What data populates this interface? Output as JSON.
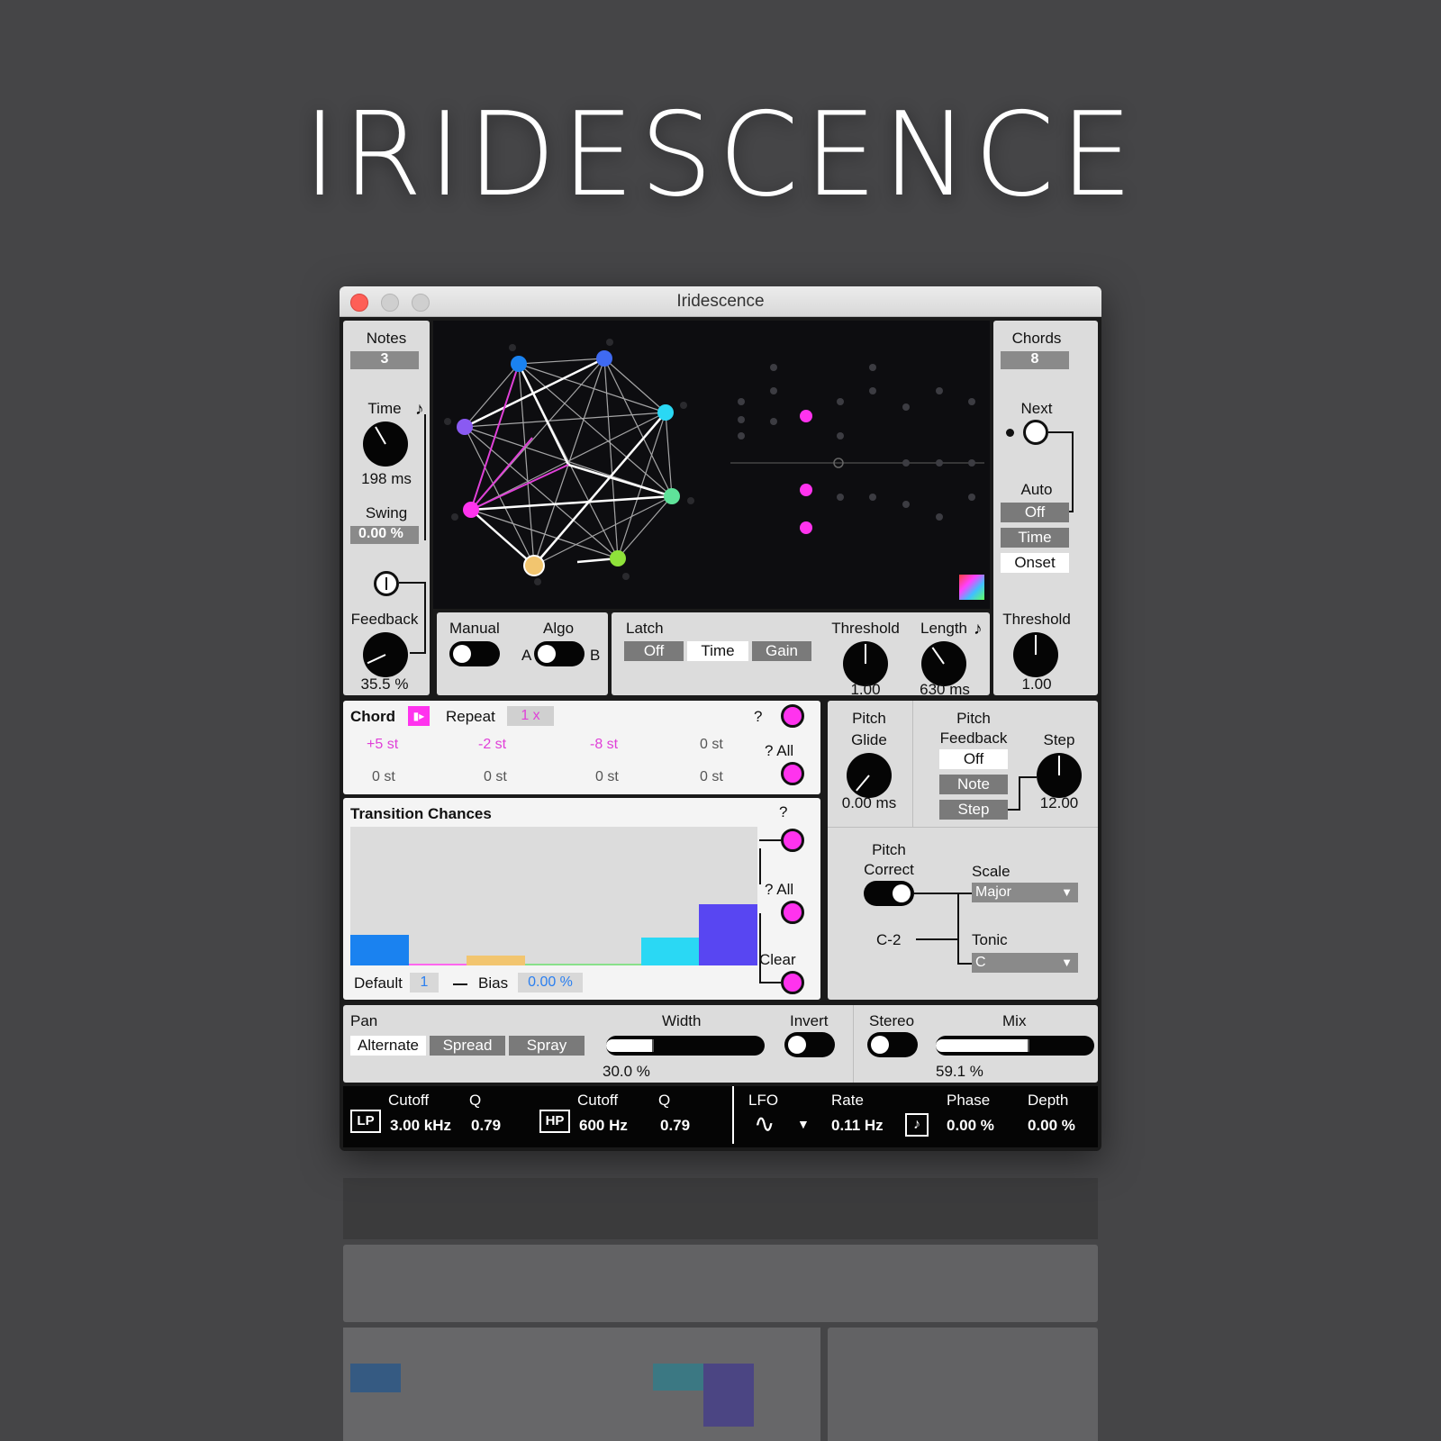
{
  "hero_title": "IRIDESCENCE",
  "window_title": "Iridescence",
  "left": {
    "notes_label": "Notes",
    "notes_value": "3",
    "time_label": "Time",
    "time_value": "198 ms",
    "swing_label": "Swing",
    "swing_value": "0.00 %",
    "feedback_label": "Feedback",
    "feedback_value": "35.5 %"
  },
  "right": {
    "chords_label": "Chords",
    "chords_value": "8",
    "next_label": "Next",
    "auto_label": "Auto",
    "auto_options": [
      "Off",
      "Time",
      "Onset"
    ],
    "threshold_label": "Threshold",
    "threshold_value": "1.00"
  },
  "controls": {
    "manual_label": "Manual",
    "algo_label": "Algo",
    "algo_a": "A",
    "algo_b": "B",
    "latch_label": "Latch",
    "latch_options": [
      "Off",
      "Time",
      "Gain"
    ],
    "threshold_label": "Threshold",
    "threshold_value": "1.00",
    "length_label": "Length",
    "length_value": "630 ms"
  },
  "chord": {
    "label": "Chord",
    "repeat_label": "Repeat",
    "repeat_value": "1 x",
    "q": "?",
    "q_all": "? All",
    "row1": [
      "+5 st",
      "-2 st",
      "-8 st",
      "0 st"
    ],
    "row2": [
      "0 st",
      "0 st",
      "0 st",
      "0 st"
    ]
  },
  "transition": {
    "label": "Transition Chances",
    "q": "?",
    "q_all": "? All",
    "clear": "Clear",
    "default_label": "Default",
    "default_value": "1",
    "bias_label": "Bias",
    "bias_value": "0.00 %",
    "bars": [
      {
        "value": 0.22,
        "color": "#1a82f0"
      },
      {
        "value": 0.01,
        "color": "#ff66ee"
      },
      {
        "value": 0.07,
        "color": "#f2c56f"
      },
      {
        "value": 0.01,
        "color": "#88e08a"
      },
      {
        "value": 0.01,
        "color": "#88e08a"
      },
      {
        "value": 0.2,
        "color": "#2ad8f4"
      },
      {
        "value": 0.44,
        "color": "#5846f2"
      }
    ]
  },
  "pitch": {
    "glide_label1": "Pitch",
    "glide_label2": "Glide",
    "glide_value": "0.00 ms",
    "feedback_label1": "Pitch",
    "feedback_label2": "Feedback",
    "feedback_options": [
      "Off",
      "Note",
      "Step"
    ],
    "step_label": "Step",
    "step_value": "12.00",
    "correct_label1": "Pitch",
    "correct_label2": "Correct",
    "scale_label": "Scale",
    "scale_value": "Major",
    "tonic_label": "Tonic",
    "tonic_value": "C",
    "low_note": "C-2"
  },
  "pan": {
    "label": "Pan",
    "options": [
      "Alternate",
      "Spread",
      "Spray"
    ],
    "width_label": "Width",
    "width_value": "30.0 %",
    "width_level": 0.3,
    "invert_label": "Invert",
    "stereo_label": "Stereo",
    "mix_label": "Mix",
    "mix_value": "59.1 %",
    "mix_level": 0.591
  },
  "filter": {
    "lp": "LP",
    "lp_cutoff_label": "Cutoff",
    "lp_cutoff": "3.00 kHz",
    "lp_q_label": "Q",
    "lp_q": "0.79",
    "hp": "HP",
    "hp_cutoff_label": "Cutoff",
    "hp_cutoff": "600 Hz",
    "hp_q_label": "Q",
    "hp_q": "0.79",
    "lfo_label": "LFO",
    "rate_label": "Rate",
    "rate": "0.11 Hz",
    "phase_label": "Phase",
    "phase": "0.00 %",
    "depth_label": "Depth",
    "depth": "0.00 %"
  },
  "colors": {
    "accent": "#ff33ee",
    "panel": "#dcdcdc",
    "display": "#0d0d10",
    "blue_value": "#2a7ff0"
  },
  "icons": {
    "note": "♪",
    "sine": "∿",
    "dropdown": "▼",
    "sync": "♪"
  }
}
